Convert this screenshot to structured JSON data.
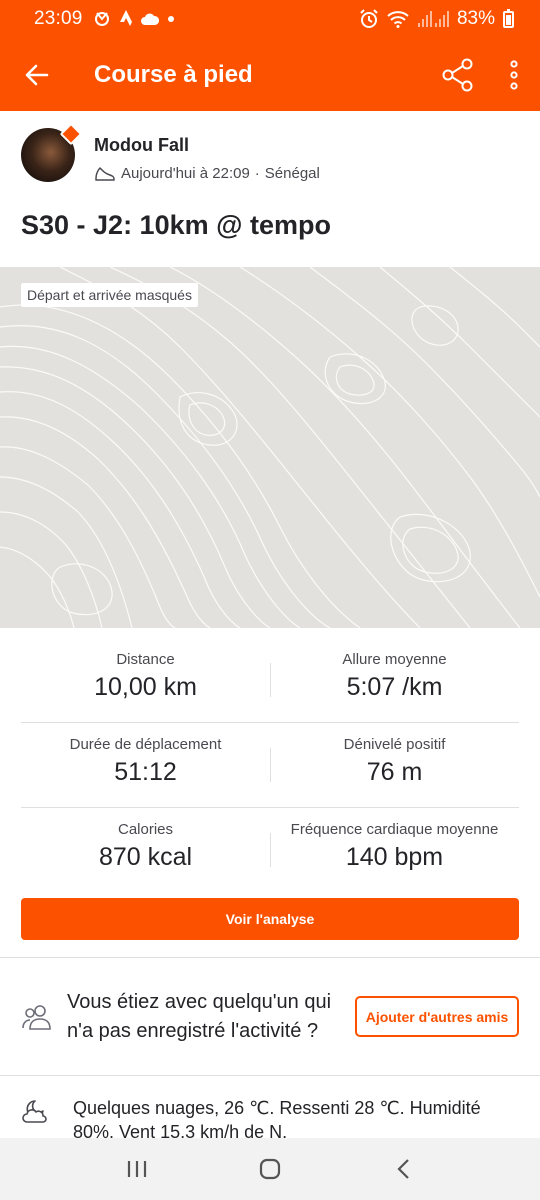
{
  "status_bar": {
    "time": "23:09",
    "battery": "83%"
  },
  "app_bar": {
    "title": "Course à pied"
  },
  "athlete": {
    "name": "Modou Fall",
    "date": "Aujourd'hui à 22:09",
    "separator": "·",
    "location": "Sénégal"
  },
  "activity": {
    "title": "S30 - J2: 10km @ tempo"
  },
  "map": {
    "privacy_label": "Départ et arrivée masqués"
  },
  "stats": [
    {
      "label": "Distance",
      "value": "10,00 km"
    },
    {
      "label": "Allure moyenne",
      "value": "5:07 /km"
    },
    {
      "label": "Durée de déplacement",
      "value": "51:12"
    },
    {
      "label": "Dénivelé positif",
      "value": "76 m"
    },
    {
      "label": "Calories",
      "value": "870 kcal"
    },
    {
      "label": "Fréquence cardiaque moyenne",
      "value": "140 bpm"
    }
  ],
  "analysis_button": "Voir l'analyse",
  "friends": {
    "text": "Vous étiez avec quelqu'un qui n'a pas enregistré l'activité ?",
    "button": "Ajouter d'autres amis"
  },
  "weather": {
    "text": "Quelques nuages, 26 ℃. Ressenti 28 ℃. Humidité 80%. Vent 15,3 km/h de N."
  },
  "colors": {
    "brand": "#fc5200",
    "map_bg": "#e3e1dd",
    "text": "#242428"
  }
}
